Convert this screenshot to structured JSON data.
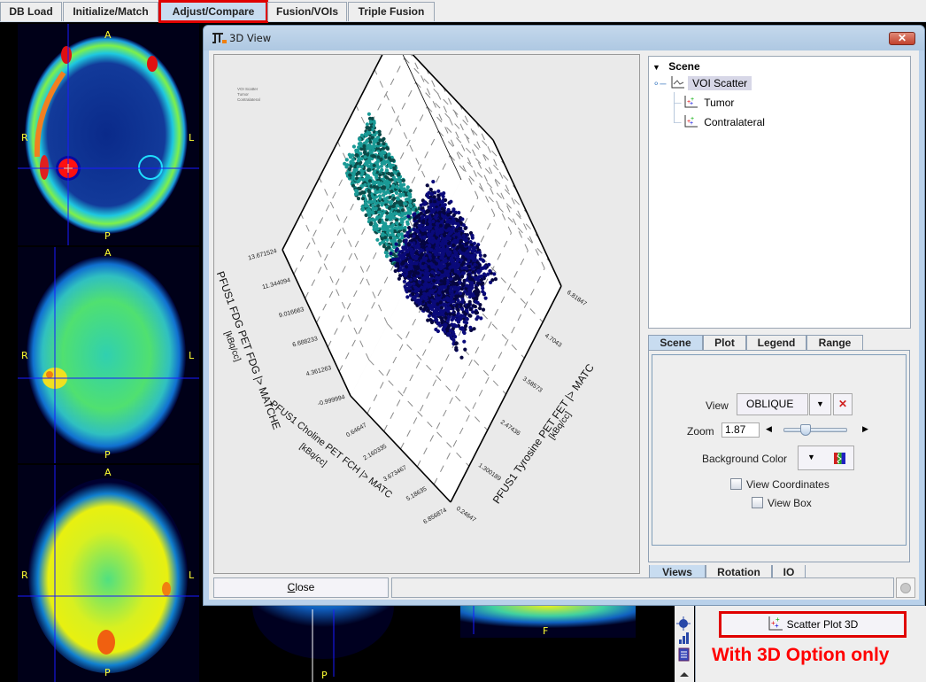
{
  "top_tabs": [
    {
      "label": "DB Load",
      "active": false
    },
    {
      "label": "Initialize/Match",
      "active": false
    },
    {
      "label": "Adjust/Compare",
      "active": true
    },
    {
      "label": "Fusion/VOIs",
      "active": false
    },
    {
      "label": "Triple Fusion",
      "active": false
    }
  ],
  "orientation_labels": {
    "anterior": "A",
    "posterior": "P",
    "right": "R",
    "left": "L",
    "foot": "F"
  },
  "window": {
    "title": "3D View",
    "close_glyph": "✕"
  },
  "scene_tree": {
    "root": "Scene",
    "selected": "VOI Scatter",
    "children": [
      "Tumor",
      "Contralateral"
    ]
  },
  "upper_tabs": [
    {
      "label": "Scene",
      "active": true
    },
    {
      "label": "Plot",
      "active": false
    },
    {
      "label": "Legend",
      "active": false
    },
    {
      "label": "Range",
      "active": false
    }
  ],
  "scene_panel": {
    "view_label": "View",
    "view_value": "OBLIQUE",
    "zoom_label": "Zoom",
    "zoom_value": "1.87",
    "zoom_slider_fraction": 0.3,
    "background_label": "Background Color",
    "view_coordinates_label": "View Coordinates",
    "view_coordinates_checked": false,
    "view_box_label": "View Box",
    "view_box_checked": false
  },
  "lower_tabs": [
    {
      "label": "Views",
      "active": true
    },
    {
      "label": "Rotation",
      "active": false
    },
    {
      "label": "IO",
      "active": false
    }
  ],
  "footer": {
    "close_label": "Close",
    "close_mnemonic": "C",
    "status_text": ""
  },
  "right_panel": {
    "scatter_button_label": "Scatter Plot 3D",
    "note": "With 3D Option only"
  },
  "colors": {
    "tumor": "#1a9a96",
    "contralateral": "#0a0a7a",
    "highlight_red": "#e00000",
    "active_tab": "#c8dcf0"
  },
  "chart_data": {
    "type": "scatter",
    "dimension": "3d",
    "view": "oblique",
    "legend_entries": [
      "VOI Scatter",
      "Tumor",
      "Contralateral"
    ],
    "legend_placement": "top-left",
    "z_axis": {
      "label": "PFUS1 FDG PET FDG |> MATCHE",
      "unit": "[kBq/cc]",
      "ticks": [
        "-0.999994",
        "4.361263",
        "6.688233",
        "9.016663",
        "11.344094",
        "13.671524"
      ]
    },
    "x_axis": {
      "label": "PFUS1 Choline PET FCH |> MATC",
      "unit": "[kBq/cc]",
      "ticks": [
        "0.64647",
        "2.160335",
        "3.673467",
        "5.18635",
        "6.856874"
      ]
    },
    "y_axis": {
      "label": "PFUS1 Tyrosine PET FET |> MATC",
      "unit": "[kBq/cc]",
      "ticks": [
        "0.24647",
        "1.300189",
        "2.47436",
        "3.58573",
        "4.7043",
        "6.81847"
      ]
    },
    "series": [
      {
        "name": "Tumor",
        "color": "#1a9a96",
        "x_range": [
          0.6,
          2.2
        ],
        "y_range": [
          0.5,
          3.0
        ],
        "z_range": [
          4.4,
          13.2
        ]
      },
      {
        "name": "Contralateral",
        "color": "#0a0a7a",
        "x_range": [
          1.5,
          6.5
        ],
        "y_range": [
          0.2,
          5.5
        ],
        "z_range": [
          -1.0,
          6.0
        ]
      }
    ],
    "grid": true
  }
}
